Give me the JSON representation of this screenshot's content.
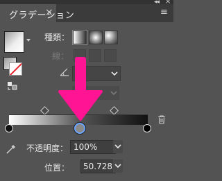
{
  "window": {
    "title": "グラデーション",
    "close_glyph": "×",
    "collapse_glyph": "◂◂",
    "close_panel_glyph": "×",
    "menu_glyph": "≡"
  },
  "type_section": {
    "label": "種類："
  },
  "stroke_section": {
    "label": "線："
  },
  "opacity": {
    "label": "不透明度：",
    "value": "100%"
  },
  "location": {
    "label": "位置：",
    "value": "50.7282%"
  },
  "gradient": {
    "selected_stop_location_percent": 50.7282,
    "colors": {
      "start": "#ffffff",
      "end": "#000000",
      "selected_stop_ring": "#6aa5ff"
    }
  },
  "annotation": {
    "arrow_color": "#ff1493"
  },
  "icons": [
    "preview-dropdown-icon",
    "swap-icon",
    "eyedropper-icon",
    "trash-icon",
    "angle-icon",
    "chevron-down-icon"
  ]
}
